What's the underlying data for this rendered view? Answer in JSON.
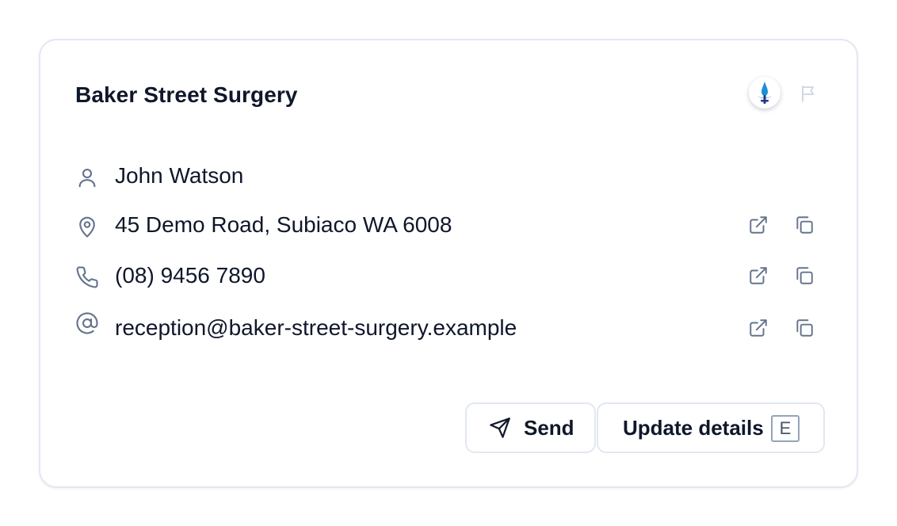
{
  "card": {
    "title": "Baker Street Surgery",
    "logo_icon": "practice-logo-icon",
    "flag_icon": "flag-icon"
  },
  "contact": {
    "name": {
      "icon": "user-icon",
      "value": "John Watson"
    },
    "address": {
      "icon": "map-pin-icon",
      "value": "45 Demo Road, Subiaco WA 6008"
    },
    "phone": {
      "icon": "phone-icon",
      "value": "(08) 9456 7890"
    },
    "email": {
      "icon": "at-sign-icon",
      "value": "reception@baker-street-surgery.example"
    }
  },
  "actions": {
    "send_label": "Send",
    "update_label": "Update details",
    "update_shortcut": "E"
  },
  "colors": {
    "text": "#0f172a",
    "icon_muted": "#64748b",
    "border": "#e2e8f0",
    "logo_blue": "#1d8fd6"
  }
}
